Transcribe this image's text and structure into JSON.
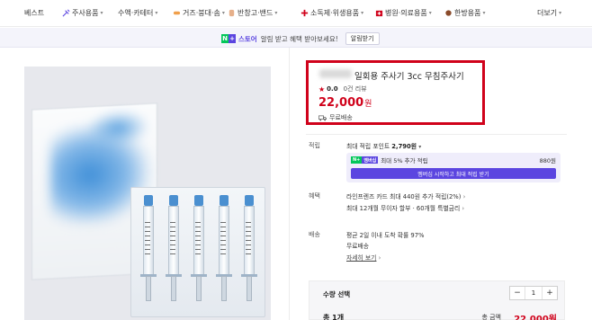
{
  "nav": {
    "items": [
      {
        "label": "베스트",
        "icon": ""
      },
      {
        "label": "주사용품",
        "icon": "syringe-icon"
      },
      {
        "label": "수액·카테터",
        "icon": "iv-bag-icon"
      },
      {
        "label": "거즈·붕대·솜",
        "icon": "bandage-icon"
      },
      {
        "label": "반창고·밴드",
        "icon": "plaster-icon"
      },
      {
        "label": "소독제·위생용품",
        "icon": "sanitizer-icon"
      },
      {
        "label": "병원·의료용품",
        "icon": "hospital-icon"
      },
      {
        "label": "한방용품",
        "icon": "herbal-icon"
      }
    ],
    "more_label": "더보기"
  },
  "promo": {
    "store_label": "스토어",
    "text": "알림 받고 혜택 받아보세요!",
    "button_label": "알림받기"
  },
  "product": {
    "title": "일회용 주사기 3cc 무침주사기",
    "rating": "0.0",
    "reviews": "0건 리뷰",
    "price": "22,000",
    "currency": "원",
    "shipping": "무료배송"
  },
  "points": {
    "label": "적립",
    "max_text": "최대 적립 포인트",
    "max_value": "2,790원",
    "membership_text": "최대 5% 추가 적립",
    "membership_value": "880원",
    "button_label": "멤버십 시작하고 최대 적립 받기"
  },
  "benefits": {
    "label": "혜택",
    "line1": "라인프렌즈 카드 최대 440원 추가 적립(2%)",
    "line2": "최대 12개월 무이자 할부 · 60개월 특별금리"
  },
  "delivery": {
    "label": "배송",
    "line1": "평균 2일 이내 도착 확률 97%",
    "line2": "무료배송",
    "link": "자세히 보기"
  },
  "quantity": {
    "label": "수량 선택",
    "value": "1",
    "minus": "−",
    "plus": "+",
    "count_label": "총 1개",
    "total_label": "총 금액",
    "total_value": "22,000원"
  },
  "colors": {
    "accent_red": "#d0021b",
    "naver_green": "#03c75a",
    "membership_purple": "#5b45e0"
  }
}
